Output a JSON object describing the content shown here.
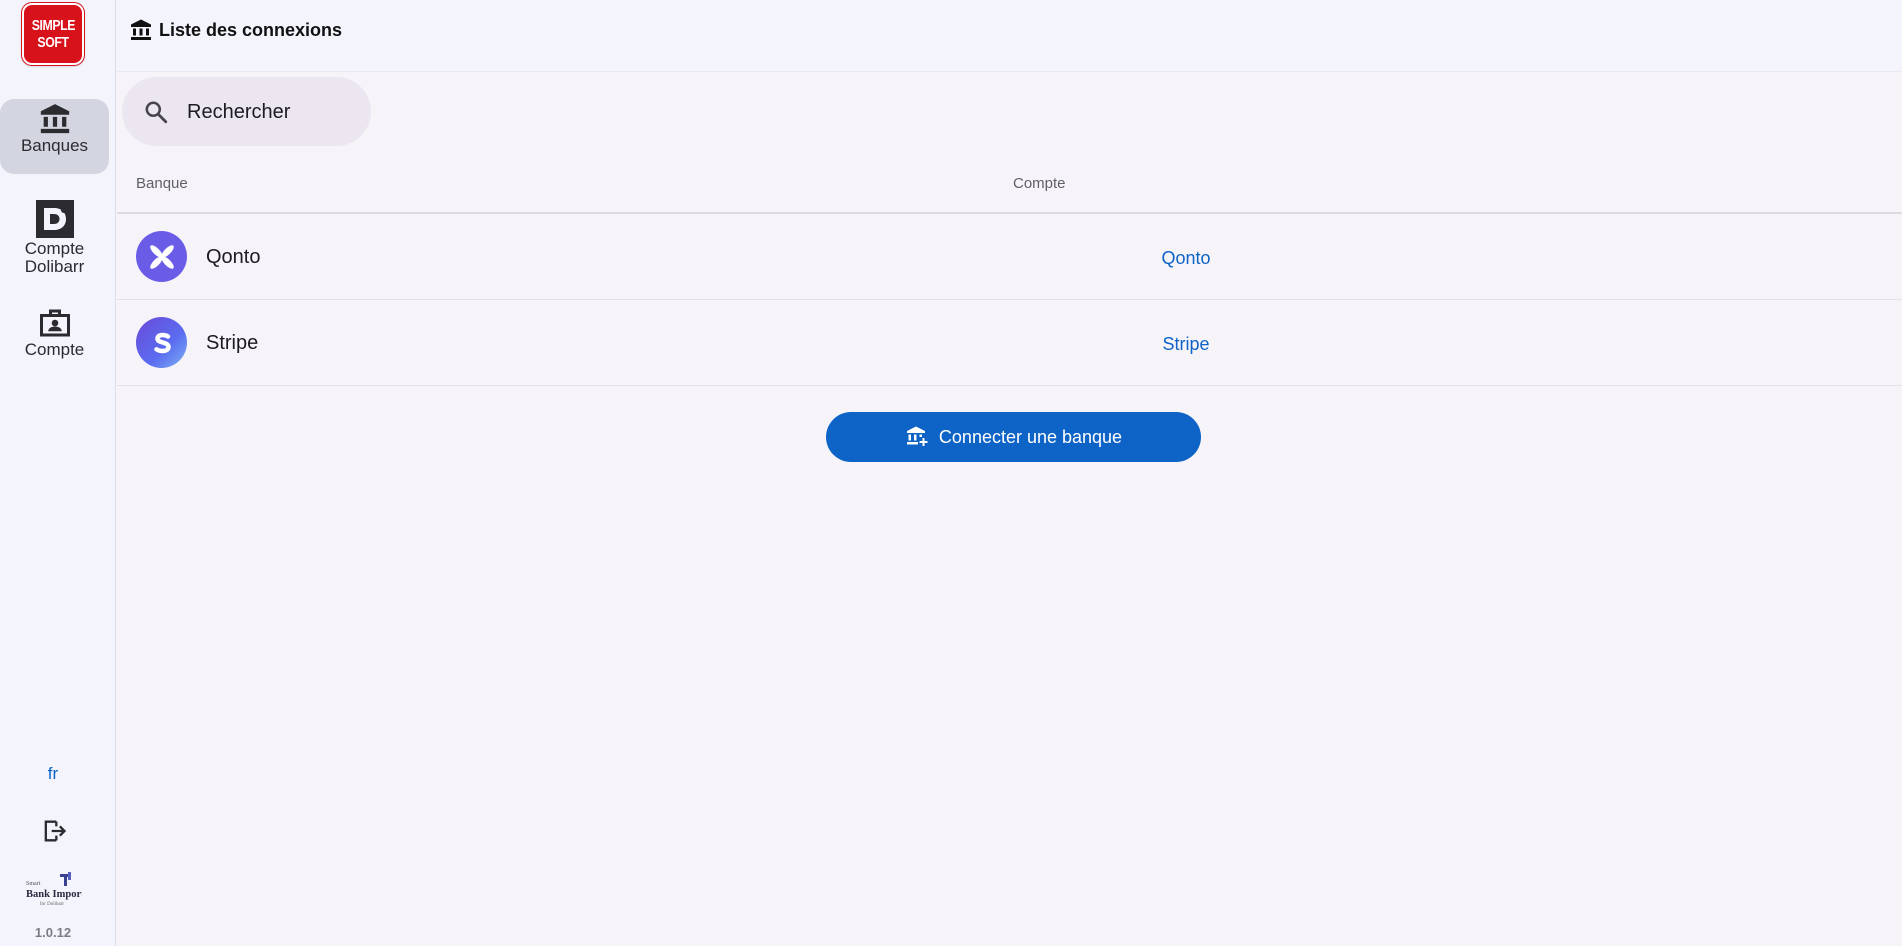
{
  "brand": {
    "logo_line1": "SIMPLE",
    "logo_line2": "SOFT",
    "logo_color": "#d8121b"
  },
  "sidebar": {
    "items": [
      {
        "label": "Banques",
        "icon": "bank-icon",
        "active": true
      },
      {
        "label": "Compte Dolibarr",
        "icon": "dolibarr-icon",
        "active": false
      },
      {
        "label": "Compte",
        "icon": "badge-icon",
        "active": false
      }
    ],
    "language": "fr",
    "logout_icon": "logout-icon",
    "app_logo": {
      "line1": "Smart",
      "line2": "Bank Import",
      "line3": "for Dolibarr"
    },
    "version": "1.0.12"
  },
  "header": {
    "title": "Liste des connexions",
    "icon": "bank-icon"
  },
  "search": {
    "placeholder": "Rechercher",
    "value": ""
  },
  "table": {
    "columns": {
      "bank": "Banque",
      "account": "Compte"
    },
    "rows": [
      {
        "bank": "Qonto",
        "account": "Qonto",
        "logo": "qonto-logo"
      },
      {
        "bank": "Stripe",
        "account": "Stripe",
        "logo": "stripe-logo"
      }
    ]
  },
  "actions": {
    "connect_label": "Connecter une banque"
  },
  "colors": {
    "accent": "#0d63c6",
    "sidebar_bg": "#f3f4fc",
    "active_nav": "#d3d5e1"
  }
}
